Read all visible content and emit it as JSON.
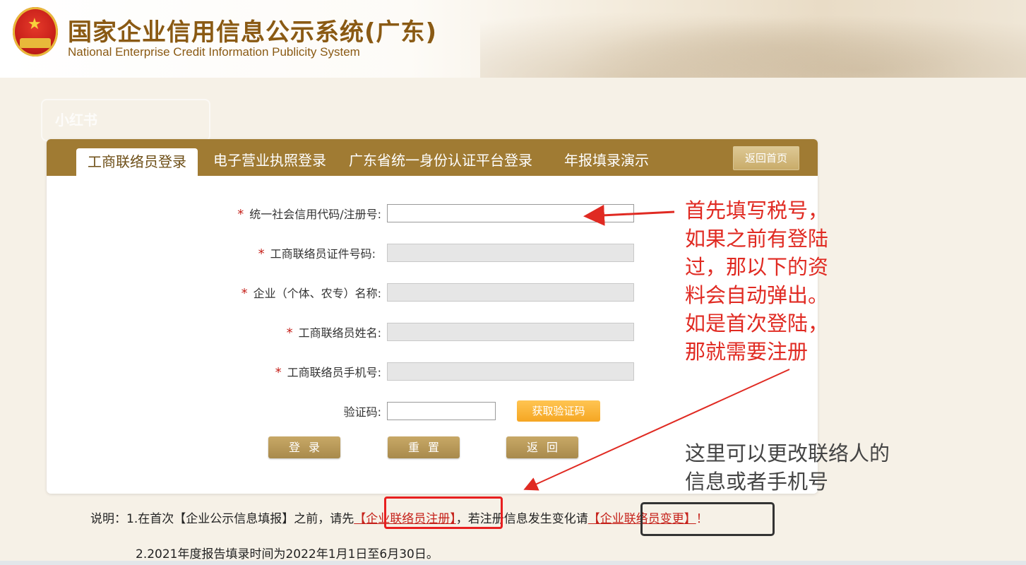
{
  "header": {
    "title": "国家企业信用信息公示系统(广东)",
    "subtitle": "National Enterprise Credit Information Publicity System"
  },
  "tabs": [
    {
      "label": "工商联络员登录",
      "active": true
    },
    {
      "label": "电子营业执照登录",
      "active": false
    },
    {
      "label": "广东省统一身份认证平台登录",
      "active": false
    },
    {
      "label": "年报填录演示",
      "active": false
    }
  ],
  "home_button": "返回首页",
  "form": {
    "required_mark": "*",
    "fields": [
      {
        "label": "统一社会信用代码/注册号:",
        "required": true,
        "enabled": true,
        "value": ""
      },
      {
        "label": "工商联络员证件号码:",
        "required": true,
        "enabled": false,
        "value": ""
      },
      {
        "label": "企业（个体、农专）名称:",
        "required": true,
        "enabled": false,
        "value": ""
      },
      {
        "label": "工商联络员姓名:",
        "required": true,
        "enabled": false,
        "value": ""
      },
      {
        "label": "工商联络员手机号:",
        "required": true,
        "enabled": false,
        "value": ""
      }
    ],
    "captcha": {
      "label": "验证码:",
      "value": "",
      "button": "获取验证码"
    },
    "buttons": {
      "login": "登录",
      "reset": "重置",
      "back": "返回"
    }
  },
  "annotations": {
    "tip1": [
      "首先填写税号，",
      "如果之前有登陆",
      "过，那以下的资",
      "料会自动弹出。",
      "如是首次登陆，",
      "那就需要注册"
    ],
    "tip2": [
      "这里可以更改联络人的",
      "信息或者手机号"
    ]
  },
  "notes": {
    "line1_prefix": "说明：1.在首次【企业公示信息填报】之前，请先",
    "register_link": "【企业联络员注册】",
    "line1_middle": "，若注册信息发生变化请",
    "change_link": "【企业联络员变更】",
    "line1_suffix": "！",
    "line2": "2.2021年度报告填录时间为2022年1月1日至6月30日。"
  },
  "watermark": "小红书",
  "colors": {
    "tab_bar": "#a07b33",
    "annotation_red": "#e02a22",
    "required_red": "#c5211a",
    "captcha_orange": "#f5a623"
  }
}
